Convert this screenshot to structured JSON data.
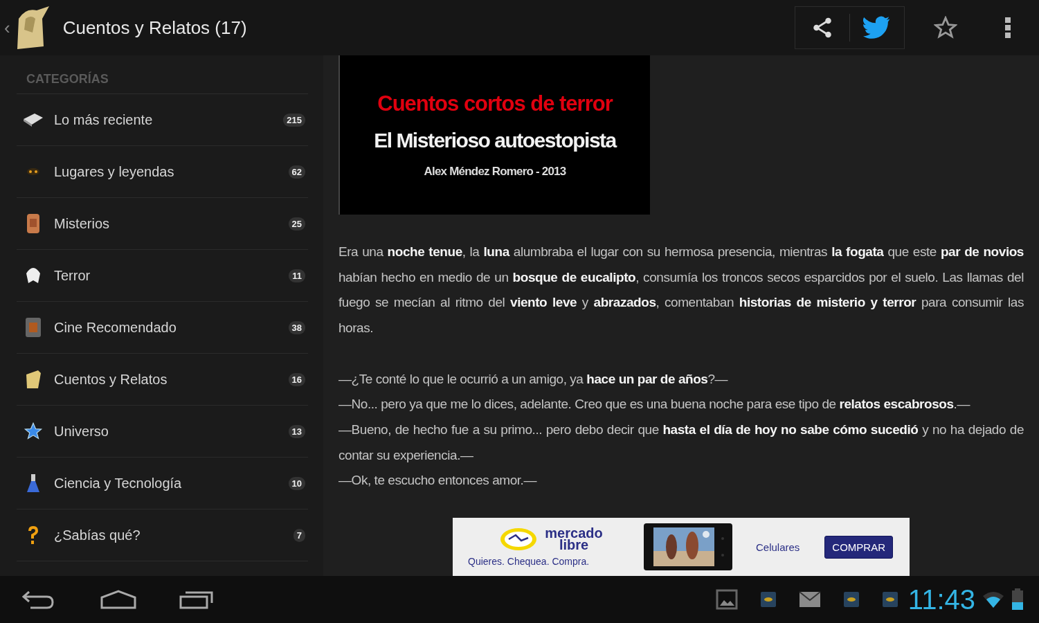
{
  "action_bar": {
    "back": "‹",
    "title": "Cuentos y Relatos (17)"
  },
  "sidebar": {
    "header": "CATEGORÍAS",
    "items": [
      {
        "label": "Lo más reciente",
        "count": "215",
        "selected": false
      },
      {
        "label": "Lugares y leyendas",
        "count": "62",
        "selected": false
      },
      {
        "label": "Misterios",
        "count": "25",
        "selected": false
      },
      {
        "label": "Terror",
        "count": "11",
        "selected": false
      },
      {
        "label": "Cine Recomendado",
        "count": "38",
        "selected": false
      },
      {
        "label": "Cuentos y Relatos",
        "count": "16",
        "selected": false
      },
      {
        "label": "Universo",
        "count": "13",
        "selected": false
      },
      {
        "label": "Ciencia y Tecnología",
        "count": "10",
        "selected": false
      },
      {
        "label": "¿Sabías qué?",
        "count": "7",
        "selected": false
      }
    ]
  },
  "article": {
    "banner": {
      "series": "Cuentos cortos de terror",
      "title": "El Misterioso autoestopista",
      "author": "Alex Méndez Romero - 2013"
    },
    "paragraphs": [
      "Era una **noche tenue**, la **luna** alumbraba el lugar con su hermosa presencia, mientras **la fogata** que este **par de novios** habían hecho en medio de un **bosque de eucalipto**, consumía los troncos secos esparcidos por el suelo. Las llamas del fuego se mecían al ritmo del **viento leve** y **abrazados**, comentaban **historias de misterio y terror** para consumir las horas.",
      "—¿Te conté lo que le ocurrió a un amigo, ya **hace un par de años**?—",
      "—No... pero ya que me lo dices, adelante. Creo que es una buena noche para ese tipo de **relatos escabrosos**.—",
      "—Bueno, de hecho fue a su primo... pero debo decir que **hasta el día de hoy no sabe cómo sucedió** y no ha dejado de contar su experiencia.—",
      "—Ok, te escucho entonces amor.—"
    ]
  },
  "ad": {
    "brand_top": "mercado",
    "brand_bottom": "libre",
    "slogan": "Quieres. Chequea. Compra.",
    "category": "Celulares",
    "button": "COMPRAR"
  },
  "status_bar": {
    "time": "11:43"
  }
}
